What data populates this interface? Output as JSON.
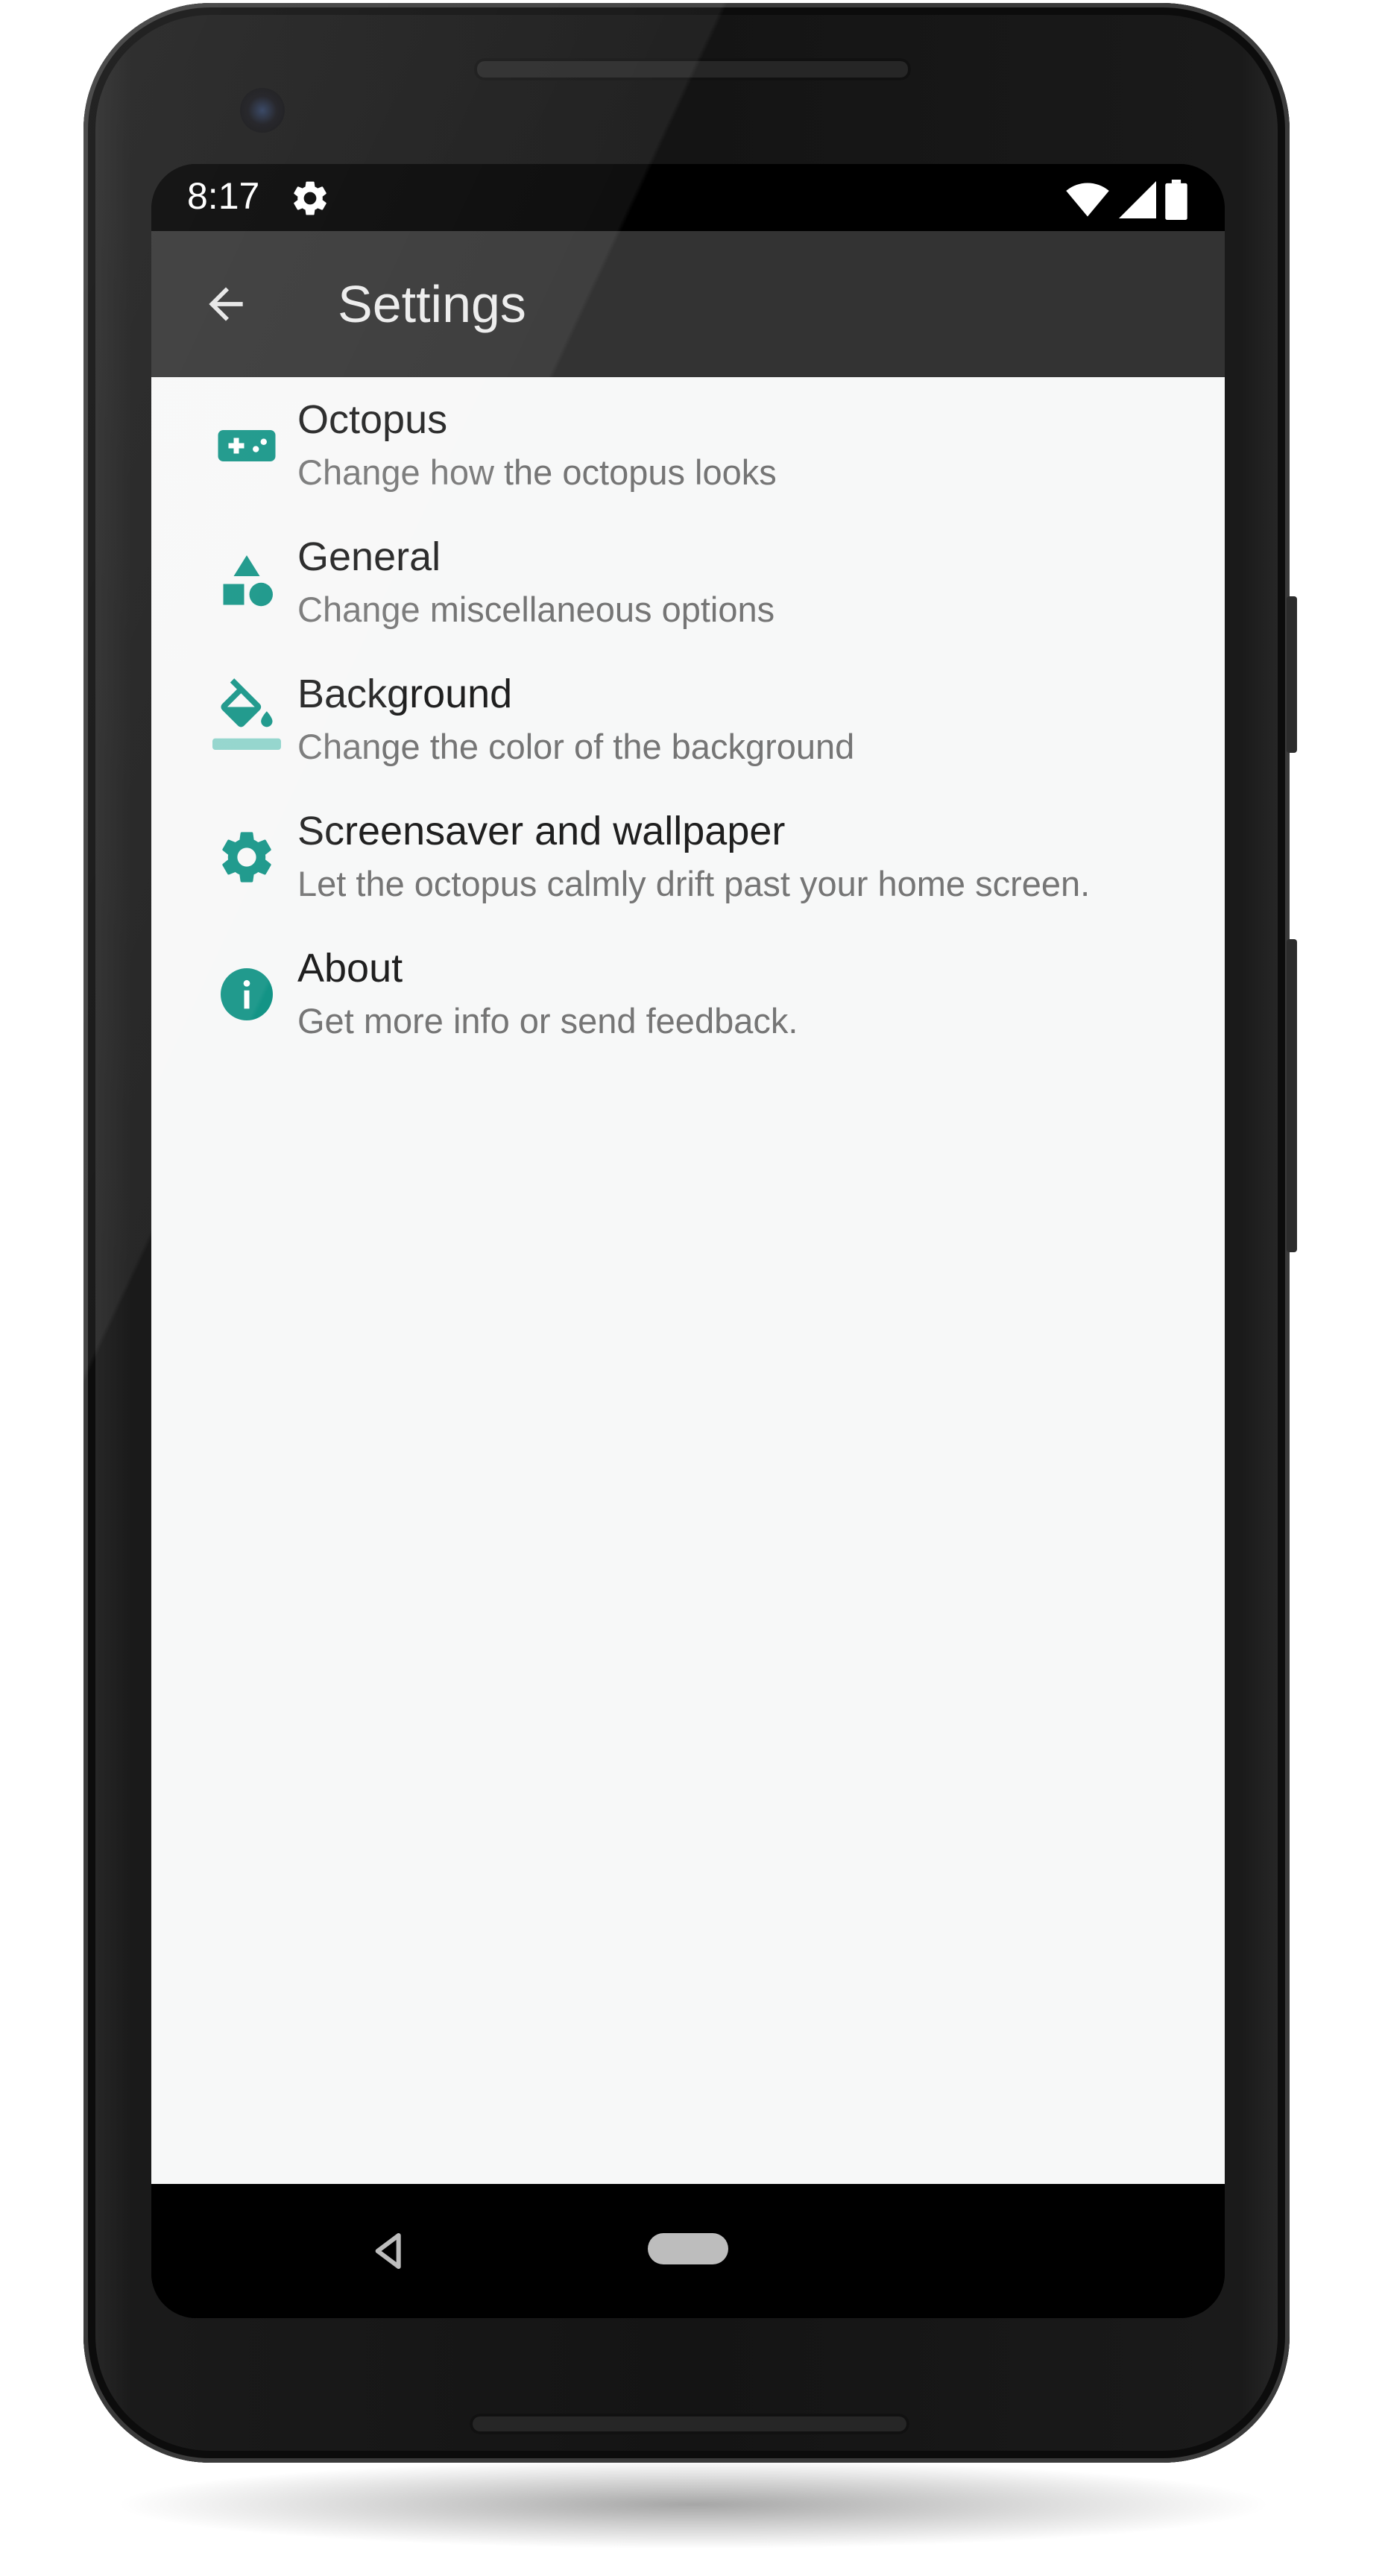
{
  "status_bar": {
    "time": "8:17",
    "icons": [
      "settings-gear-icon",
      "wifi-icon",
      "signal-icon",
      "battery-icon"
    ]
  },
  "toolbar": {
    "title": "Settings",
    "back_icon": "arrow-back-icon"
  },
  "preferences": [
    {
      "title": "Octopus",
      "summary": "Change how the octopus looks",
      "icon": "gamepad-icon"
    },
    {
      "title": "General",
      "summary": "Change miscellaneous options",
      "icon": "shapes-icon"
    },
    {
      "title": "Background",
      "summary": "Change the color of the background",
      "icon": "paint-bucket-icon"
    },
    {
      "title": "Screensaver and wallpaper",
      "summary": "Let the octopus calmly drift past your home screen.",
      "icon": "gear-icon"
    },
    {
      "title": "About",
      "summary": "Get more info or send feedback.",
      "icon": "info-icon"
    }
  ],
  "nav_bar": {
    "back_icon": "nav-back-triangle-icon",
    "home_icon": "nav-home-pill-icon"
  },
  "colors": {
    "accent": "#139486",
    "toolbar": "#333333",
    "background": "#f7f8f8",
    "title_text": "#1f1f1f",
    "summary_text": "#757575"
  }
}
